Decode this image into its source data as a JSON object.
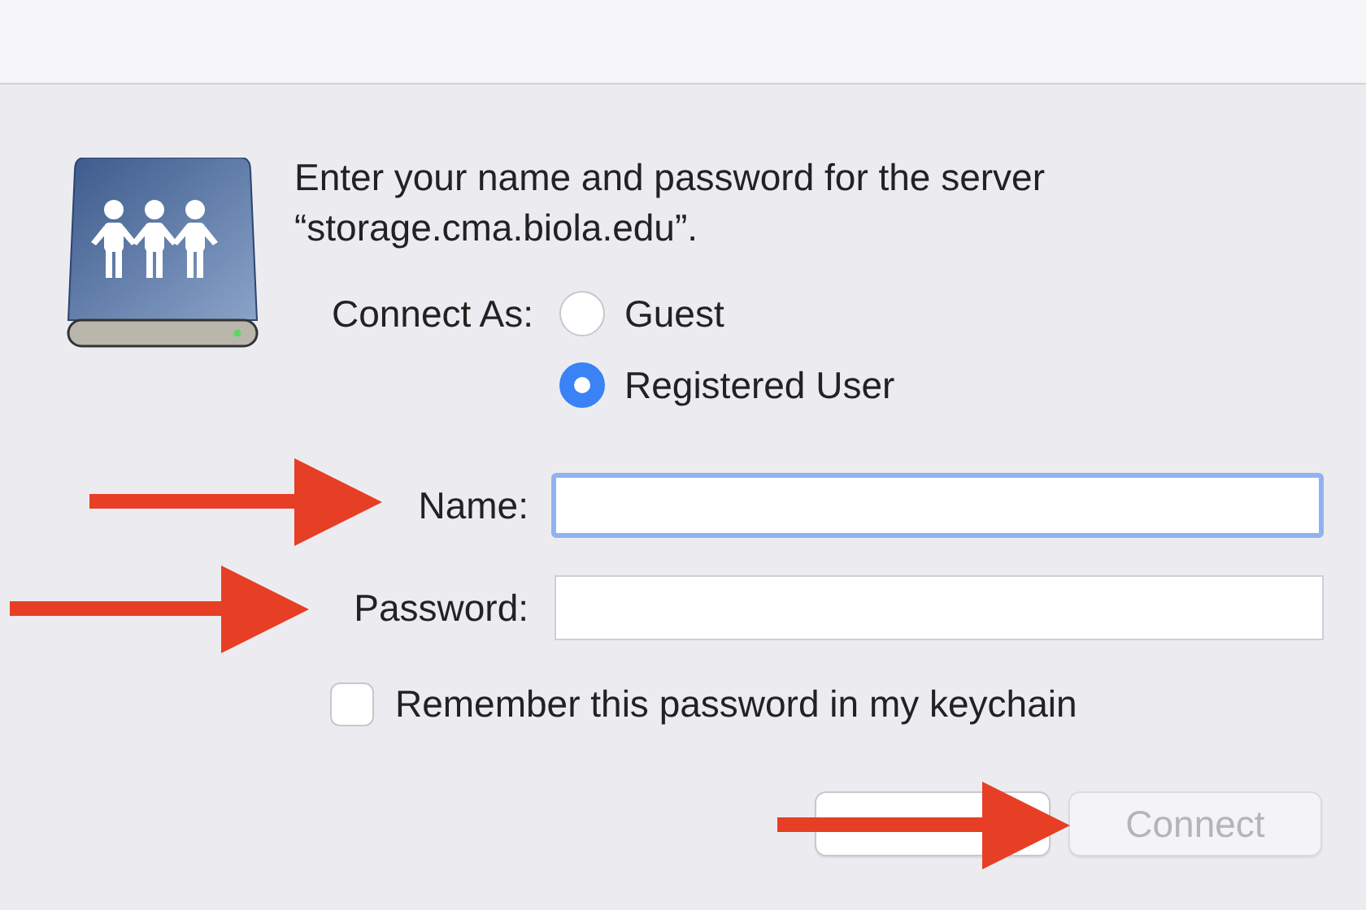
{
  "message": {
    "line1": "Enter your name and password for the server",
    "line2": "“storage.cma.biola.edu”."
  },
  "connect_as": {
    "label": "Connect As:",
    "options": [
      {
        "label": "Guest",
        "selected": false
      },
      {
        "label": "Registered User",
        "selected": true
      }
    ]
  },
  "fields": [
    {
      "label": "Name:",
      "focused": true
    },
    {
      "label": "Password:",
      "focused": false
    }
  ],
  "remember": {
    "label": "Remember this password in my keychain",
    "checked": false
  },
  "buttons": [
    {
      "disabled": false
    },
    {
      "label": "Connect",
      "disabled": true
    }
  ],
  "annotations": [
    {
      "kind": "arrow"
    },
    {
      "kind": "arrow"
    },
    {
      "kind": "arrow"
    }
  ]
}
